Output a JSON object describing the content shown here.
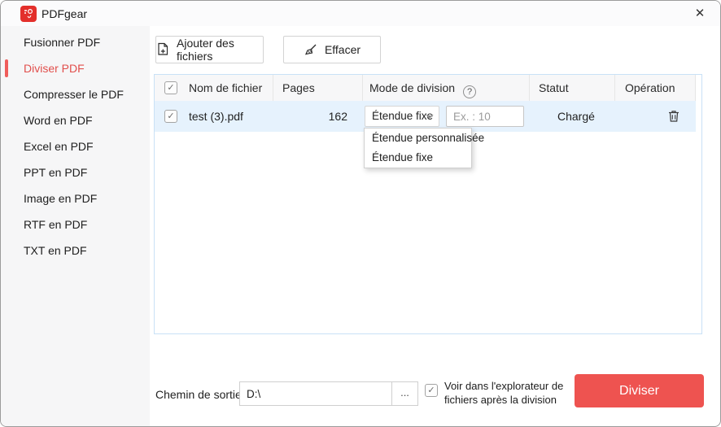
{
  "window": {
    "title": "PDFgear"
  },
  "icons": {
    "close": "✕",
    "check": "✓",
    "help": "?",
    "ellipsis": "..."
  },
  "sidebar": {
    "items": [
      {
        "label": "Fusionner PDF",
        "active": false
      },
      {
        "label": "Diviser PDF",
        "active": true
      },
      {
        "label": "Compresser le PDF",
        "active": false
      },
      {
        "label": "Word en PDF",
        "active": false
      },
      {
        "label": "Excel en PDF",
        "active": false
      },
      {
        "label": "PPT en PDF",
        "active": false
      },
      {
        "label": "Image en PDF",
        "active": false
      },
      {
        "label": "RTF en PDF",
        "active": false
      },
      {
        "label": "TXT en PDF",
        "active": false
      }
    ]
  },
  "toolbar": {
    "add_files_label": "Ajouter des fichiers",
    "clear_label": "Effacer"
  },
  "table": {
    "columns": {
      "name": "Nom de fichier",
      "pages": "Pages",
      "mode": "Mode de division",
      "status": "Statut",
      "operation": "Opération"
    },
    "row": {
      "name": "test (3).pdf",
      "pages": "162",
      "mode_selected": "Étendue fixe",
      "range_placeholder": "Ex. : 10",
      "status": "Chargé"
    }
  },
  "dropdown": {
    "options": [
      {
        "label": "Étendue personnalisée"
      },
      {
        "label": "Étendue fixe"
      }
    ]
  },
  "footer": {
    "output_path_label": "Chemin de sortie",
    "output_path_value": "D:\\",
    "open_after_line1": "Voir dans l'explorateur de",
    "open_after_line2": "fichiers après la division",
    "split_label": "Diviser"
  },
  "colors": {
    "accent_red": "#ee5350",
    "sidebar_active_red": "#e14f4c",
    "table_border_blue": "#c9e1f6",
    "row_selected_blue": "#e6f2fd",
    "header_gray": "#f7f7f8"
  }
}
